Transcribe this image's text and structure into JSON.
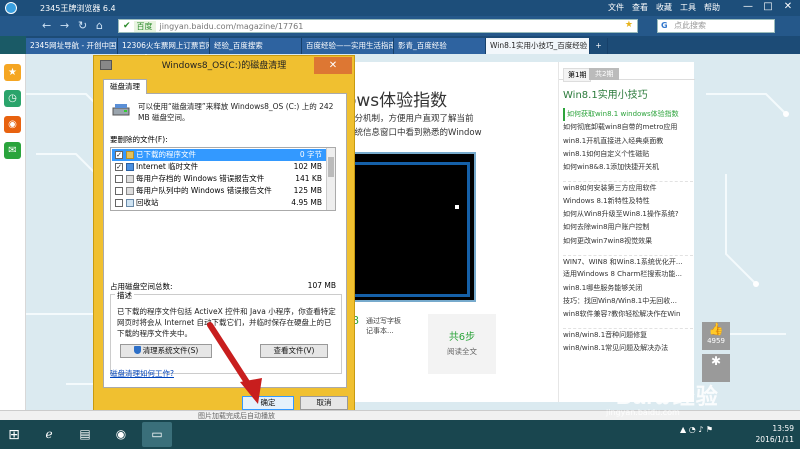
{
  "window": {
    "app_title": "2345王牌浏览器 6.4",
    "menu": [
      "文件",
      "查看",
      "收藏",
      "工具",
      "帮助"
    ],
    "controls": [
      "—",
      "□",
      "✕"
    ]
  },
  "navbar": {
    "site_badge": "百度",
    "url": "jingyan.baidu.com/magazine/17761",
    "search_placeholder": "点此搜索"
  },
  "tabs": [
    {
      "label": "2345网址导航 - 开创中国百"
    },
    {
      "label": "12306火车票网上订票官网"
    },
    {
      "label": "经验_百度搜索"
    },
    {
      "label": "百度经验——实用生活指南"
    },
    {
      "label": "影青_百度经验"
    },
    {
      "label": "Win8.1实用小技巧_百度经验",
      "active": true
    }
  ],
  "article": {
    "heading": "ows体验指数",
    "para_line1": "评分机制，方便用户直观了解当前",
    "para_line2": "系统信息窗口中看到熟悉的Window",
    "step_num": "8",
    "step_text_1": "通过写字板",
    "step_text_2": "记事本...",
    "total_steps": "共6步",
    "read_full": "阅读全文"
  },
  "rightcol": {
    "tab1": "第1期",
    "tab2": "共2期",
    "title": "Win8.1实用小技巧",
    "items": [
      {
        "text": "如何获取win8.1 windows体验指数",
        "hl": true
      },
      {
        "text": "如何彻底卸载win8自带的metro应用"
      },
      {
        "text": "win8.1开机直接进入经典桌面教"
      },
      {
        "text": "win8.1如何自定义个性磁贴"
      },
      {
        "text": "如何win8&8.1添加快捷开关机"
      },
      {
        "text": "win8如何安装第三方应用软件",
        "gap": true
      },
      {
        "text": "Windows 8.1新特性及特性"
      },
      {
        "text": "如何从Win8升级至Win8.1操作系统?"
      },
      {
        "text": "如何去除win8用户账户控制"
      },
      {
        "text": "如何更改win7win8视觉效果"
      },
      {
        "text": "WIN7、WIN8 和Win8.1系统优化开...",
        "gap": true
      },
      {
        "text": "适用Windows 8 Charm栏搜索功能..."
      },
      {
        "text": "win8.1哪些服务能够关闭"
      },
      {
        "text": "技巧：找回Win8/Win8.1中无回收..."
      },
      {
        "text": "win8软件兼容?教你轻松解决作在Win"
      },
      {
        "text": "win8/win8.1音种问题修复",
        "gap": true
      },
      {
        "text": "win8/win8.1常见问题及解决办法"
      }
    ],
    "float_count": "4959"
  },
  "dialog": {
    "title": "Windows8_OS(C:)的磁盘清理",
    "close": "✕",
    "tab": "磁盘清理",
    "intro": "可以使用“磁盘清理”来释放 Windows8_OS (C:) 上的 242 MB 磁盘空间。",
    "files_label": "要删除的文件(F):",
    "files": [
      {
        "name": "已下载的程序文件",
        "size": "0 字节",
        "checked": true,
        "selected": true
      },
      {
        "name": "Internet 临时文件",
        "size": "102 MB",
        "checked": true
      },
      {
        "name": "每用户存档的 Windows 错误报告文件",
        "size": "141 KB",
        "checked": false
      },
      {
        "name": "每用户队列中的 Windows 错误报告文件",
        "size": "125 MB",
        "checked": false
      },
      {
        "name": "回收站",
        "size": "4.95 MB",
        "checked": false
      }
    ],
    "total_label": "占用磁盘空间总数:",
    "total_value": "107 MB",
    "desc_legend": "描述",
    "desc_text": "已下载的程序文件包括 ActiveX 控件和 Java 小程序，你查看特定网页时将会从 Internet 自动下载它们，并临时保存在硬盘上的已下载的程序文件夹中。",
    "clean_system_btn": "清理系统文件(S)",
    "view_files_btn": "查看文件(V)",
    "how_link": "磁盘清理如何工作?",
    "ok": "确定",
    "cancel": "取消"
  },
  "watermark": {
    "brand": "Bai",
    "brand2": "经验",
    "sub": "jingyan.baidu.com"
  },
  "statusbar": {
    "text": "图片加载完成后自动播放"
  },
  "taskbar": {
    "time": "13:59",
    "date": "2016/1/11"
  },
  "colors": {
    "dialog_frame": "#f0c030",
    "selection": "#3399ff",
    "green_accent": "#2da43c",
    "arrow": "#c81e1e"
  }
}
